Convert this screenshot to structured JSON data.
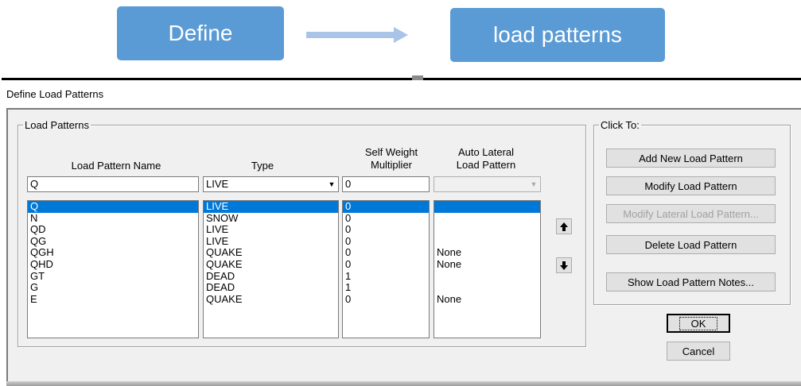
{
  "banner": {
    "define_label": "Define",
    "patterns_label": "load patterns"
  },
  "dialog": {
    "title": "Define Load Patterns",
    "load_patterns_group": "Load Patterns",
    "click_to_group": "Click To:",
    "headers": {
      "name": "Load Pattern Name",
      "type": "Type",
      "self_weight_line1": "Self Weight",
      "self_weight_line2": "Multiplier",
      "auto_lateral_line1": "Auto Lateral",
      "auto_lateral_line2": "Load Pattern"
    },
    "inputs": {
      "name": "Q",
      "type": "LIVE",
      "self_weight": "0",
      "auto_lateral": ""
    },
    "rows": [
      {
        "name": "Q",
        "type": "LIVE",
        "self_weight": "0",
        "auto_lateral": "",
        "selected": true
      },
      {
        "name": "N",
        "type": "SNOW",
        "self_weight": "0",
        "auto_lateral": ""
      },
      {
        "name": "QD",
        "type": "LIVE",
        "self_weight": "0",
        "auto_lateral": ""
      },
      {
        "name": "QG",
        "type": "LIVE",
        "self_weight": "0",
        "auto_lateral": ""
      },
      {
        "name": "QGH",
        "type": "QUAKE",
        "self_weight": "0",
        "auto_lateral": "None"
      },
      {
        "name": "QHD",
        "type": "QUAKE",
        "self_weight": "0",
        "auto_lateral": "None"
      },
      {
        "name": "GT",
        "type": "DEAD",
        "self_weight": "1",
        "auto_lateral": ""
      },
      {
        "name": "G",
        "type": "DEAD",
        "self_weight": "1",
        "auto_lateral": ""
      },
      {
        "name": "E",
        "type": "QUAKE",
        "self_weight": "0",
        "auto_lateral": "None"
      }
    ],
    "buttons": {
      "add": "Add New Load Pattern",
      "modify": "Modify Load Pattern",
      "modify_lateral": "Modify Lateral Load Pattern...",
      "delete": "Delete Load Pattern",
      "notes": "Show Load Pattern Notes...",
      "ok": "OK",
      "cancel": "Cancel"
    }
  },
  "colors": {
    "banner_blue": "#5b9bd5",
    "selection_blue": "#0078d7",
    "dialog_bg": "#f0f0f0"
  }
}
